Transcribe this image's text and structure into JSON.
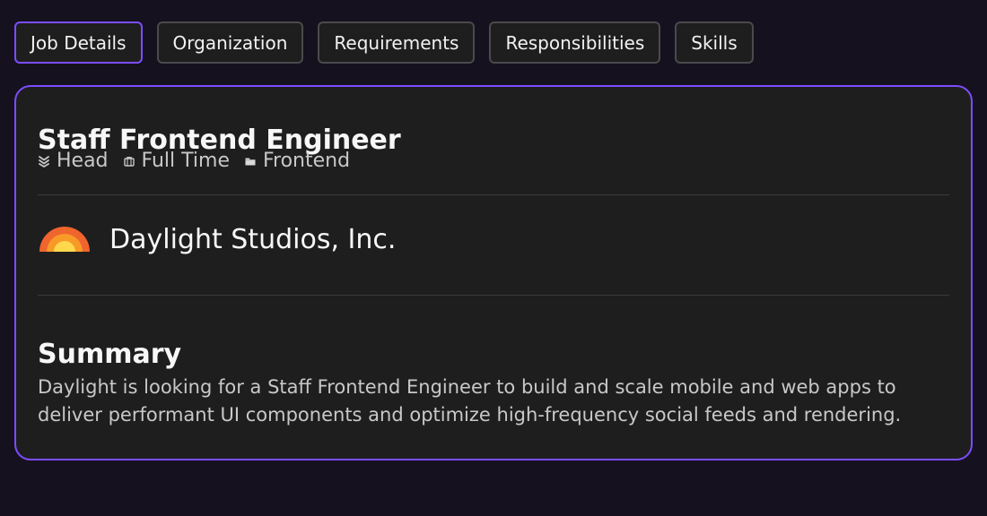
{
  "tabs": [
    {
      "label": "Job Details",
      "active": true
    },
    {
      "label": "Organization",
      "active": false
    },
    {
      "label": "Requirements",
      "active": false
    },
    {
      "label": "Responsibilities",
      "active": false
    },
    {
      "label": "Skills",
      "active": false
    }
  ],
  "job": {
    "title": "Staff Frontend Engineer",
    "meta": [
      {
        "icon": "rank-chevron-icon",
        "label": "Head"
      },
      {
        "icon": "briefcase-icon",
        "label": "Full Time"
      },
      {
        "icon": "folder-icon",
        "label": "Frontend"
      }
    ]
  },
  "company": {
    "name": "Daylight Studios, Inc.",
    "logo": "sunrise-logo-icon",
    "logo_colors": [
      "#f0642d",
      "#f89a28",
      "#ffd84d"
    ]
  },
  "summary": {
    "title": "Summary",
    "text": "Daylight is looking for a Staff Frontend Engineer to build and scale mobile and web apps to deliver performant UI components and optimize high-frequency social feeds and rendering."
  },
  "colors": {
    "background": "#16111f",
    "card": "#1e1e1e",
    "accent": "#7b4dff",
    "tab_border": "#4a4a4d",
    "text": "#f7f7f7",
    "muted_text": "#c8c8c8"
  }
}
